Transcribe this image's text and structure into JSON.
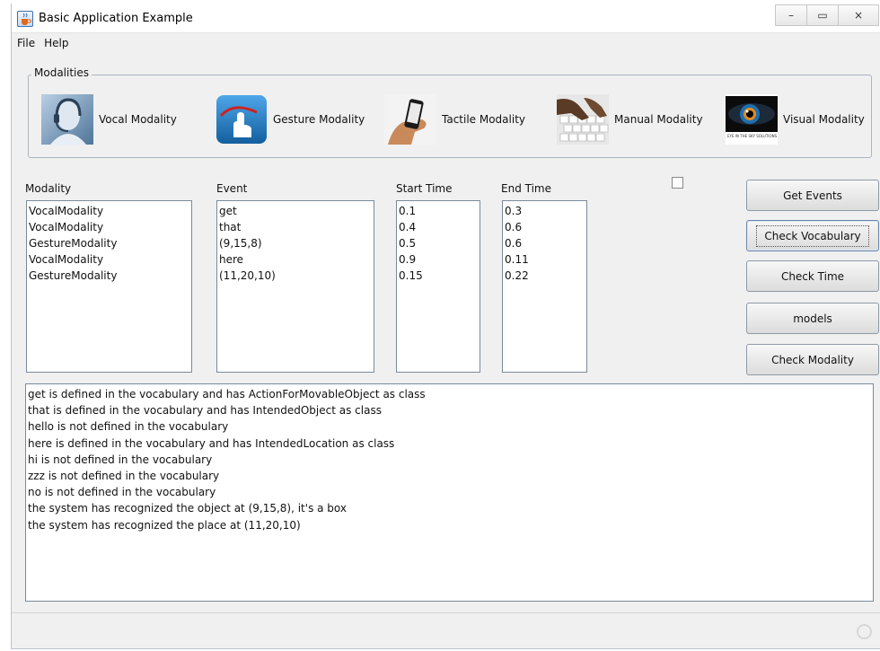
{
  "window": {
    "title": "Basic Application Example",
    "minimize": "–",
    "maximize": "▭",
    "close": "×"
  },
  "menu": [
    "File",
    "Help"
  ],
  "modalities": {
    "legend": "Modalities",
    "items": [
      {
        "label": "Vocal Modality",
        "icon": "headset-operator-icon"
      },
      {
        "label": "Gesture Modality",
        "icon": "touch-hand-icon"
      },
      {
        "label": "Tactile Modality",
        "icon": "smartphone-hand-icon"
      },
      {
        "label": "Manual Modality",
        "icon": "keyboard-hand-icon"
      },
      {
        "label": "Visual Modality",
        "icon": "eye-icon"
      }
    ],
    "eye_logo_text": "EYE IN THE SKY SOLUTIONS"
  },
  "columns": {
    "modality": {
      "header": "Modality",
      "items": [
        "VocalModality",
        "VocalModality",
        "GestureModality",
        "VocalModality",
        "GestureModality"
      ]
    },
    "event": {
      "header": "Event",
      "items": [
        "get",
        "that",
        "(9,15,8)",
        "here",
        "(11,20,10)"
      ]
    },
    "start": {
      "header": "Start Time",
      "items": [
        "0.1",
        "0.4",
        "0.5",
        "0.9",
        "0.15"
      ]
    },
    "end": {
      "header": "End Time",
      "items": [
        "0.3",
        "0.6",
        "0.6",
        "0.11",
        "0.22"
      ]
    }
  },
  "checkbox": {
    "checked": false
  },
  "buttons": [
    "Get Events",
    "Check Vocabulary",
    "Check Time",
    "models",
    "Check Modality"
  ],
  "output": [
    "get is defined in the vocabulary and has ActionForMovableObject as class",
    "that is defined in the vocabulary and has IntendedObject as class",
    "hello is not defined in the vocabulary",
    "here is defined in the vocabulary and has IntendedLocation as class",
    "hi is not defined in the vocabulary",
    "zzz is not defined in the vocabulary",
    "no is not defined in the vocabulary",
    "the system has recognized the object at (9,15,8), it's a box",
    "the system has recognized the place at (11,20,10)"
  ]
}
